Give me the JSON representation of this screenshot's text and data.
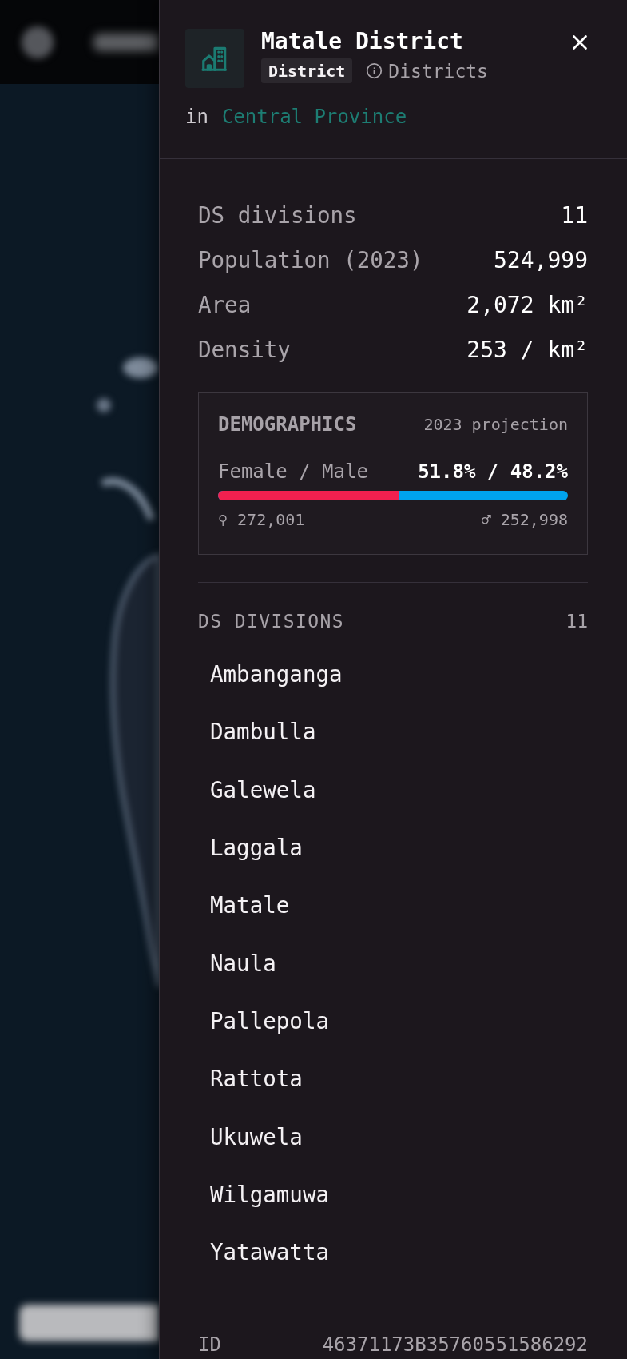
{
  "panel": {
    "title": "Matale District",
    "badge": "District",
    "layer_link": "Districts",
    "parent_prefix": "in",
    "parent_link": "Central Province",
    "stats": [
      {
        "label": "DS divisions",
        "value": "11"
      },
      {
        "label": "Population (2023)",
        "value": "524,999"
      },
      {
        "label": "Area",
        "value": "2,072 km²"
      },
      {
        "label": "Density",
        "value": "253 / km²"
      }
    ],
    "demographics": {
      "title": "DEMOGRAPHICS",
      "note": "2023 projection",
      "ratio_label": "Female / Male",
      "ratio_value": "51.8% / 48.2%",
      "bar": {
        "level": 0.518
      },
      "female_count": "♀ 272,001",
      "male_count": "♂ 252,998"
    },
    "divisions": {
      "title": "DS DIVISIONS",
      "count": "11",
      "items": [
        "Ambanganga",
        "Dambulla",
        "Galewela",
        "Laggala",
        "Matale",
        "Naula",
        "Pallepola",
        "Rattota",
        "Ukuwela",
        "Wilgamuwa",
        "Yatawatta"
      ]
    },
    "id": {
      "label": "ID",
      "value": "46371173B35760551586292"
    }
  }
}
